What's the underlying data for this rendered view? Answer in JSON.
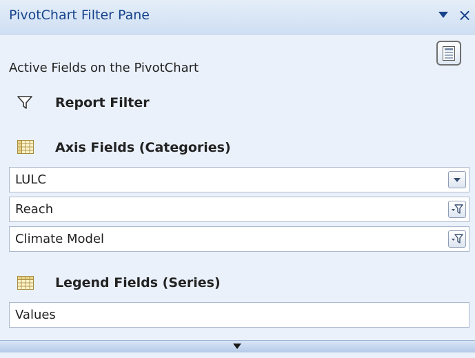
{
  "pane": {
    "title": "PivotChart Filter Pane",
    "menu_icon": "dropdown-triangle-icon",
    "close_glyph": "×",
    "layout_button_icon": "field-list-layout-icon"
  },
  "active_fields_label": "Active Fields on the PivotChart",
  "sections": {
    "report_filter": {
      "label": "Report Filter",
      "icon": "filter-funnel-icon"
    },
    "axis_fields": {
      "label": "Axis Fields (Categories)",
      "icon": "grid-table-icon",
      "items": [
        {
          "label": "LULC",
          "button_icon": "dropdown-arrow-icon"
        },
        {
          "label": "Reach",
          "button_icon": "filter-applied-icon"
        },
        {
          "label": "Climate Model",
          "button_icon": "filter-applied-icon"
        }
      ]
    },
    "legend_fields": {
      "label": "Legend Fields (Series)",
      "icon": "grid-table-icon",
      "items": [
        {
          "label": "Values"
        }
      ]
    }
  },
  "colors": {
    "title_text": "#15428b",
    "pane_background": "#eaf1fb",
    "field_border": "#abb9cc"
  }
}
